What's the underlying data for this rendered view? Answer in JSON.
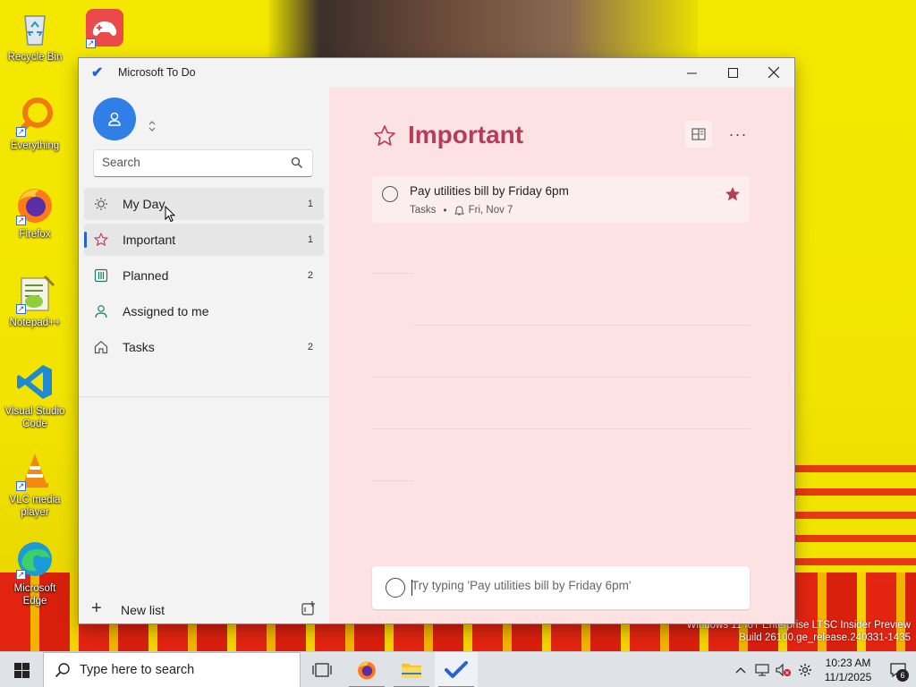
{
  "desktop": {
    "icons": [
      {
        "label": "Recycle Bin",
        "icon": "recycle-bin-icon"
      },
      {
        "label": "",
        "icon": "game-app-icon"
      },
      {
        "label": "Everything",
        "icon": "everything-search-icon"
      },
      {
        "label": "Firefox",
        "icon": "firefox-icon"
      },
      {
        "label": "Notepad++",
        "icon": "notepad-plus-plus-icon"
      },
      {
        "label": "Visual Studio Code",
        "icon": "vscode-icon"
      },
      {
        "label": "VLC media player",
        "icon": "vlc-icon"
      },
      {
        "label": "Microsoft Edge",
        "icon": "edge-icon"
      }
    ],
    "watermark_line1": "Windows 11 IoT Enterprise LTSC Insider Preview",
    "watermark_line2": "Build 26100.ge_release.240331-1435"
  },
  "window": {
    "title": "Microsoft To Do",
    "minimize": "—",
    "maximize": "☐",
    "close": "✕"
  },
  "sidebar": {
    "account_toggle": "⌃⌄",
    "search_placeholder": "Search",
    "items": [
      {
        "label": "My Day",
        "count": "1",
        "icon": "sun-icon"
      },
      {
        "label": "Important",
        "count": "1",
        "icon": "star-icon"
      },
      {
        "label": "Planned",
        "count": "2",
        "icon": "calendar-icon"
      },
      {
        "label": "Assigned to me",
        "count": "",
        "icon": "person-icon"
      },
      {
        "label": "Tasks",
        "count": "2",
        "icon": "home-icon"
      }
    ],
    "new_list_label": "New list",
    "new_list_plus": "+"
  },
  "main": {
    "title": "Important",
    "more": "···",
    "task": {
      "title": "Pay utilities bill by Friday 6pm",
      "list": "Tasks",
      "separator": "•",
      "reminder": "Fri, Nov 7",
      "starred": true
    },
    "add_task_placeholder": "Try typing 'Pay utilities bill by Friday 6pm'"
  },
  "taskbar": {
    "search_placeholder": "Type here to search",
    "time": "10:23 AM",
    "date": "11/1/2025",
    "notifications": "6"
  },
  "colors": {
    "accent": "#2564cf",
    "important_title": "#b73c57",
    "main_bg": "#fde2e4",
    "star": "#b73c57"
  }
}
